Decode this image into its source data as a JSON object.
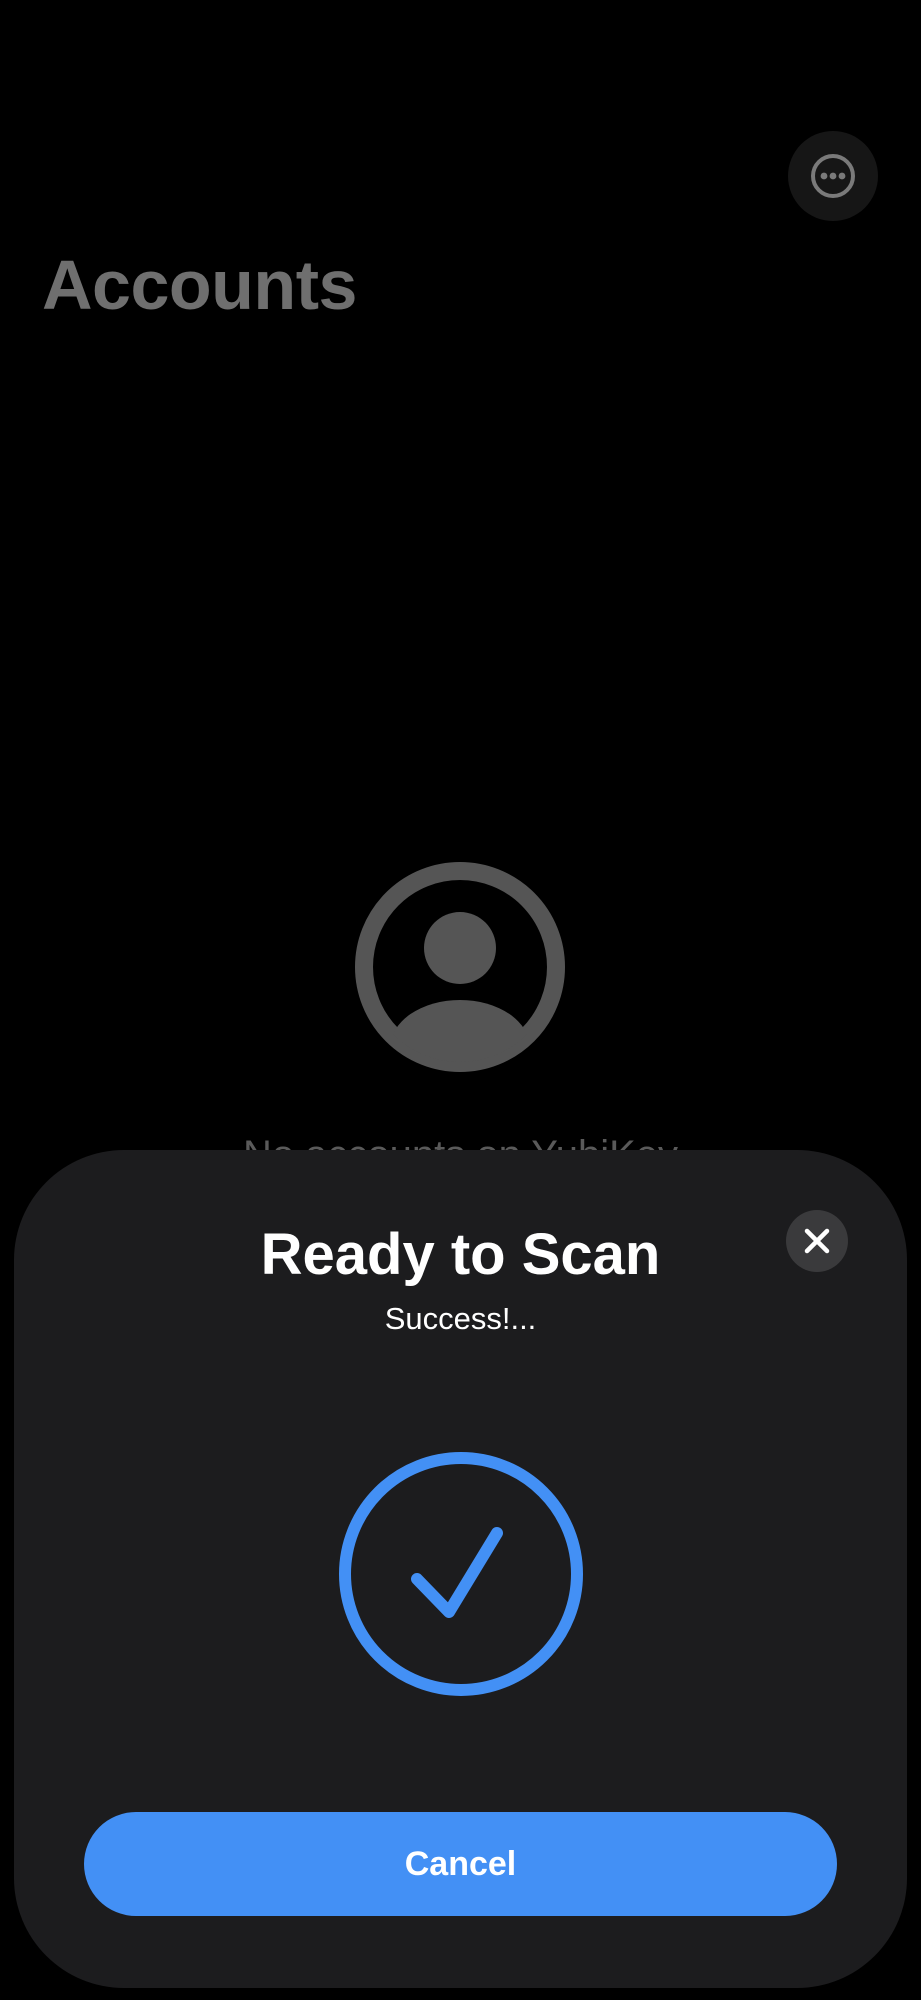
{
  "header": {
    "title": "Accounts",
    "more_button_icon": "ellipsis-circle-icon"
  },
  "empty_state": {
    "avatar_icon": "person-circle-icon",
    "message": "No accounts on YubiKey"
  },
  "scan_sheet": {
    "title": "Ready to Scan",
    "status": "Success!...",
    "close_icon": "close-icon",
    "status_icon": "checkmark-circle-icon",
    "cancel_label": "Cancel",
    "accent_color": "#4390f5"
  }
}
